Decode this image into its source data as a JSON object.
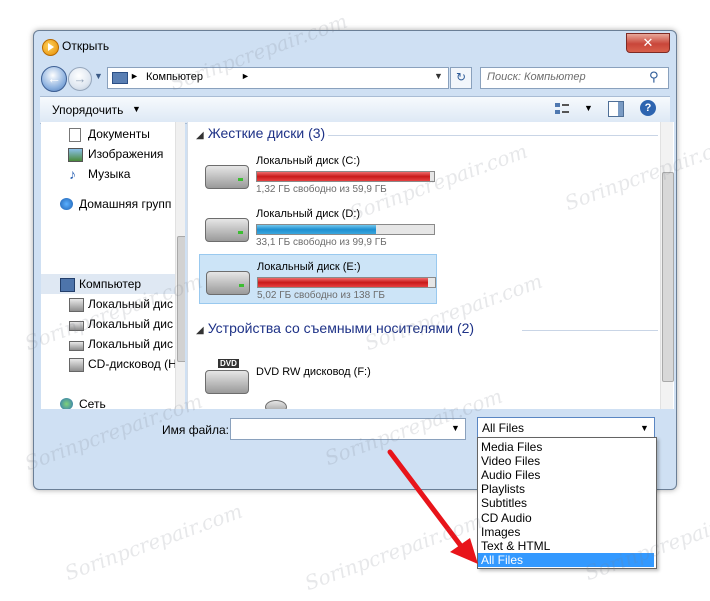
{
  "window": {
    "title": "Открыть",
    "close_label": "✕"
  },
  "navigation": {
    "back_icon": "arrow-left-icon",
    "forward_icon": "arrow-right-icon",
    "address_text": "Компьютер",
    "search_placeholder": "Поиск: Компьютер"
  },
  "toolbar": {
    "organize_label": "Упорядочить",
    "help_label": "?"
  },
  "sidebar": {
    "items": [
      {
        "label": "Документы",
        "icon": "documents-icon"
      },
      {
        "label": "Изображения",
        "icon": "pictures-icon"
      },
      {
        "label": "Музыка",
        "icon": "music-icon"
      },
      {
        "label": "Домашняя групп",
        "icon": "homegroup-icon"
      },
      {
        "label": "Компьютер",
        "icon": "computer-icon"
      },
      {
        "label": "Локальный дис",
        "icon": "drive-icon"
      },
      {
        "label": "Локальный дис",
        "icon": "drive-icon"
      },
      {
        "label": "Локальный дис",
        "icon": "drive-icon"
      },
      {
        "label": "CD-дисковод (H",
        "icon": "cd-drive-icon"
      },
      {
        "label": "Сеть",
        "icon": "network-icon"
      }
    ]
  },
  "content": {
    "hard_disks_header": "Жесткие диски (3)",
    "removable_header": "Устройства со съемными носителями (2)",
    "drives": [
      {
        "name": "Локальный диск (C:)",
        "free": "1,32 ГБ свободно из 59,9 ГБ",
        "used_fraction": 0.98,
        "bar_color": "red"
      },
      {
        "name": "Локальный диск (D:)",
        "free": "33,1 ГБ свободно из 99,9 ГБ",
        "used_fraction": 0.67,
        "bar_color": "blue"
      },
      {
        "name": "Локальный диск (E:)",
        "free": "5,02 ГБ свободно из 138 ГБ",
        "used_fraction": 0.96,
        "bar_color": "red"
      }
    ],
    "dvd_drive_name": "DVD RW дисковод (F:)",
    "dvd_badge": "DVD"
  },
  "bottom": {
    "filename_label": "Имя файла:",
    "filename_value": "",
    "filter_value": "All Files"
  },
  "filter_options": [
    "Media Files",
    "Video Files",
    "Audio Files",
    "Playlists",
    "Subtitles",
    "CD Audio",
    "Images",
    "Text & HTML",
    "All Files"
  ],
  "filter_selected_index": 8,
  "watermark": "Sorinpcrepair.com",
  "colors": {
    "accent": "#3399ff",
    "annotation": "#e8141a"
  }
}
